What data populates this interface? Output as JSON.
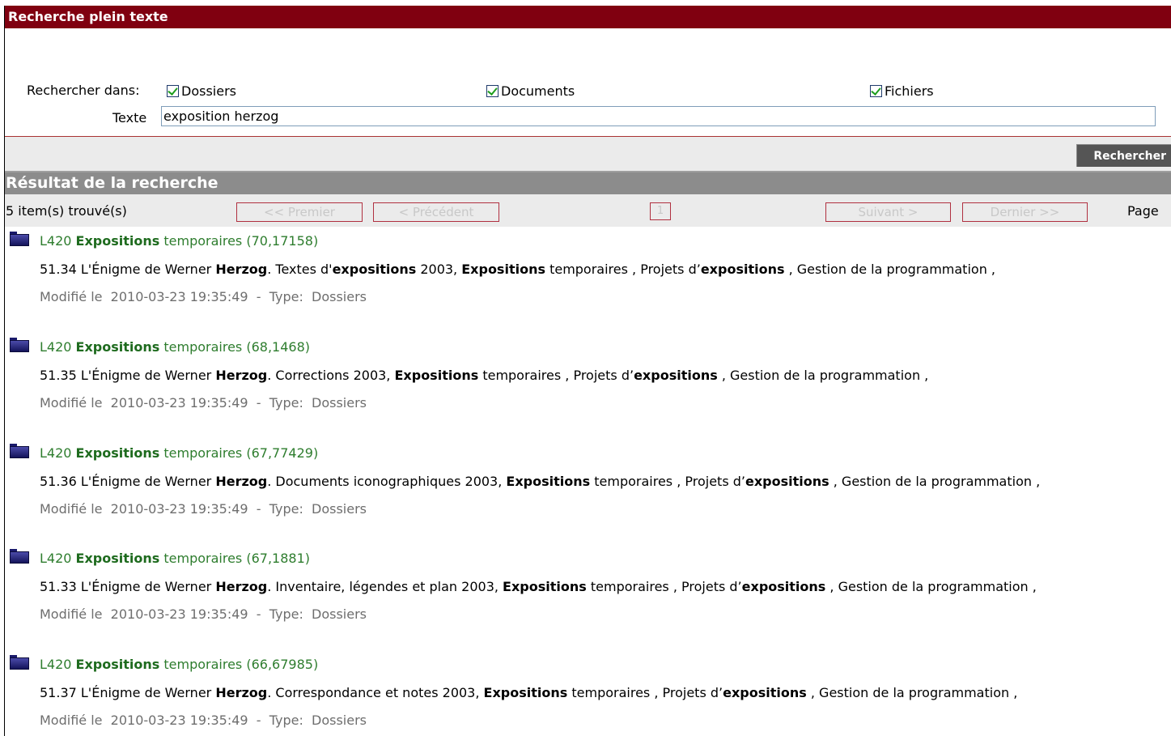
{
  "search": {
    "header": "Recherche plein texte",
    "search_in_label": "Rechercher dans:",
    "checkboxes": [
      {
        "label": "Dossiers",
        "checked": true
      },
      {
        "label": "Documents",
        "checked": true
      },
      {
        "label": "Fichiers",
        "checked": true
      }
    ],
    "text_label": "Texte",
    "text_value": "exposition herzog",
    "button_label": "Rechercher"
  },
  "results": {
    "header": "Résultat de la recherche",
    "count_text": "5 item(s) trouvé(s)",
    "pager": {
      "first": "<< Premier",
      "previous": "< Précédent",
      "current_page": "1",
      "next": "Suivant >",
      "last": "Dernier >>",
      "page_label": "Page"
    },
    "items": [
      {
        "title_prefix": "L420 ",
        "title_bold": "Expositions",
        "title_suffix": " temporaires (70,17158)",
        "desc": [
          {
            "t": "51.34 L'Énigme de Werner ",
            "b": false
          },
          {
            "t": "Herzog",
            "b": true
          },
          {
            "t": ". Textes d'",
            "b": false
          },
          {
            "t": "expositions",
            "b": true
          },
          {
            "t": " 2003, ",
            "b": false
          },
          {
            "t": "Expositions",
            "b": true
          },
          {
            "t": " temporaires , Projets d’",
            "b": false
          },
          {
            "t": "expositions",
            "b": true
          },
          {
            "t": " , Gestion de la programmation ,",
            "b": false
          }
        ],
        "meta": "Modifié le  2010-03-23 19:35:49  -  Type:  Dossiers"
      },
      {
        "title_prefix": "L420 ",
        "title_bold": "Expositions",
        "title_suffix": " temporaires (68,1468)",
        "desc": [
          {
            "t": "51.35 L'Énigme de Werner ",
            "b": false
          },
          {
            "t": "Herzog",
            "b": true
          },
          {
            "t": ". Corrections 2003, ",
            "b": false
          },
          {
            "t": "Expositions",
            "b": true
          },
          {
            "t": " temporaires , Projets d’",
            "b": false
          },
          {
            "t": "expositions",
            "b": true
          },
          {
            "t": " , Gestion de la programmation ,",
            "b": false
          }
        ],
        "meta": "Modifié le  2010-03-23 19:35:49  -  Type:  Dossiers"
      },
      {
        "title_prefix": "L420 ",
        "title_bold": "Expositions",
        "title_suffix": " temporaires (67,77429)",
        "desc": [
          {
            "t": "51.36 L'Énigme de Werner ",
            "b": false
          },
          {
            "t": "Herzog",
            "b": true
          },
          {
            "t": ". Documents iconographiques 2003, ",
            "b": false
          },
          {
            "t": "Expositions",
            "b": true
          },
          {
            "t": " temporaires , Projets d’",
            "b": false
          },
          {
            "t": "expositions",
            "b": true
          },
          {
            "t": " , Gestion de la programmation ,",
            "b": false
          }
        ],
        "meta": "Modifié le  2010-03-23 19:35:49  -  Type:  Dossiers"
      },
      {
        "title_prefix": "L420 ",
        "title_bold": "Expositions",
        "title_suffix": " temporaires (67,1881)",
        "desc": [
          {
            "t": "51.33 L'Énigme de Werner ",
            "b": false
          },
          {
            "t": "Herzog",
            "b": true
          },
          {
            "t": ". Inventaire, légendes et plan 2003, ",
            "b": false
          },
          {
            "t": "Expositions",
            "b": true
          },
          {
            "t": " temporaires , Projets d’",
            "b": false
          },
          {
            "t": "expositions",
            "b": true
          },
          {
            "t": " , Gestion de la programmation ,",
            "b": false
          }
        ],
        "meta": "Modifié le  2010-03-23 19:35:49  -  Type:  Dossiers"
      },
      {
        "title_prefix": "L420 ",
        "title_bold": "Expositions",
        "title_suffix": " temporaires (66,67985)",
        "desc": [
          {
            "t": "51.37 L'Énigme de Werner ",
            "b": false
          },
          {
            "t": "Herzog",
            "b": true
          },
          {
            "t": ". Correspondance et notes 2003, ",
            "b": false
          },
          {
            "t": "Expositions",
            "b": true
          },
          {
            "t": " temporaires , Projets d’",
            "b": false
          },
          {
            "t": "expositions",
            "b": true
          },
          {
            "t": " , Gestion de la programmation ,",
            "b": false
          }
        ],
        "meta": "Modifié le  2010-03-23 19:35:49  -  Type:  Dossiers"
      }
    ]
  }
}
